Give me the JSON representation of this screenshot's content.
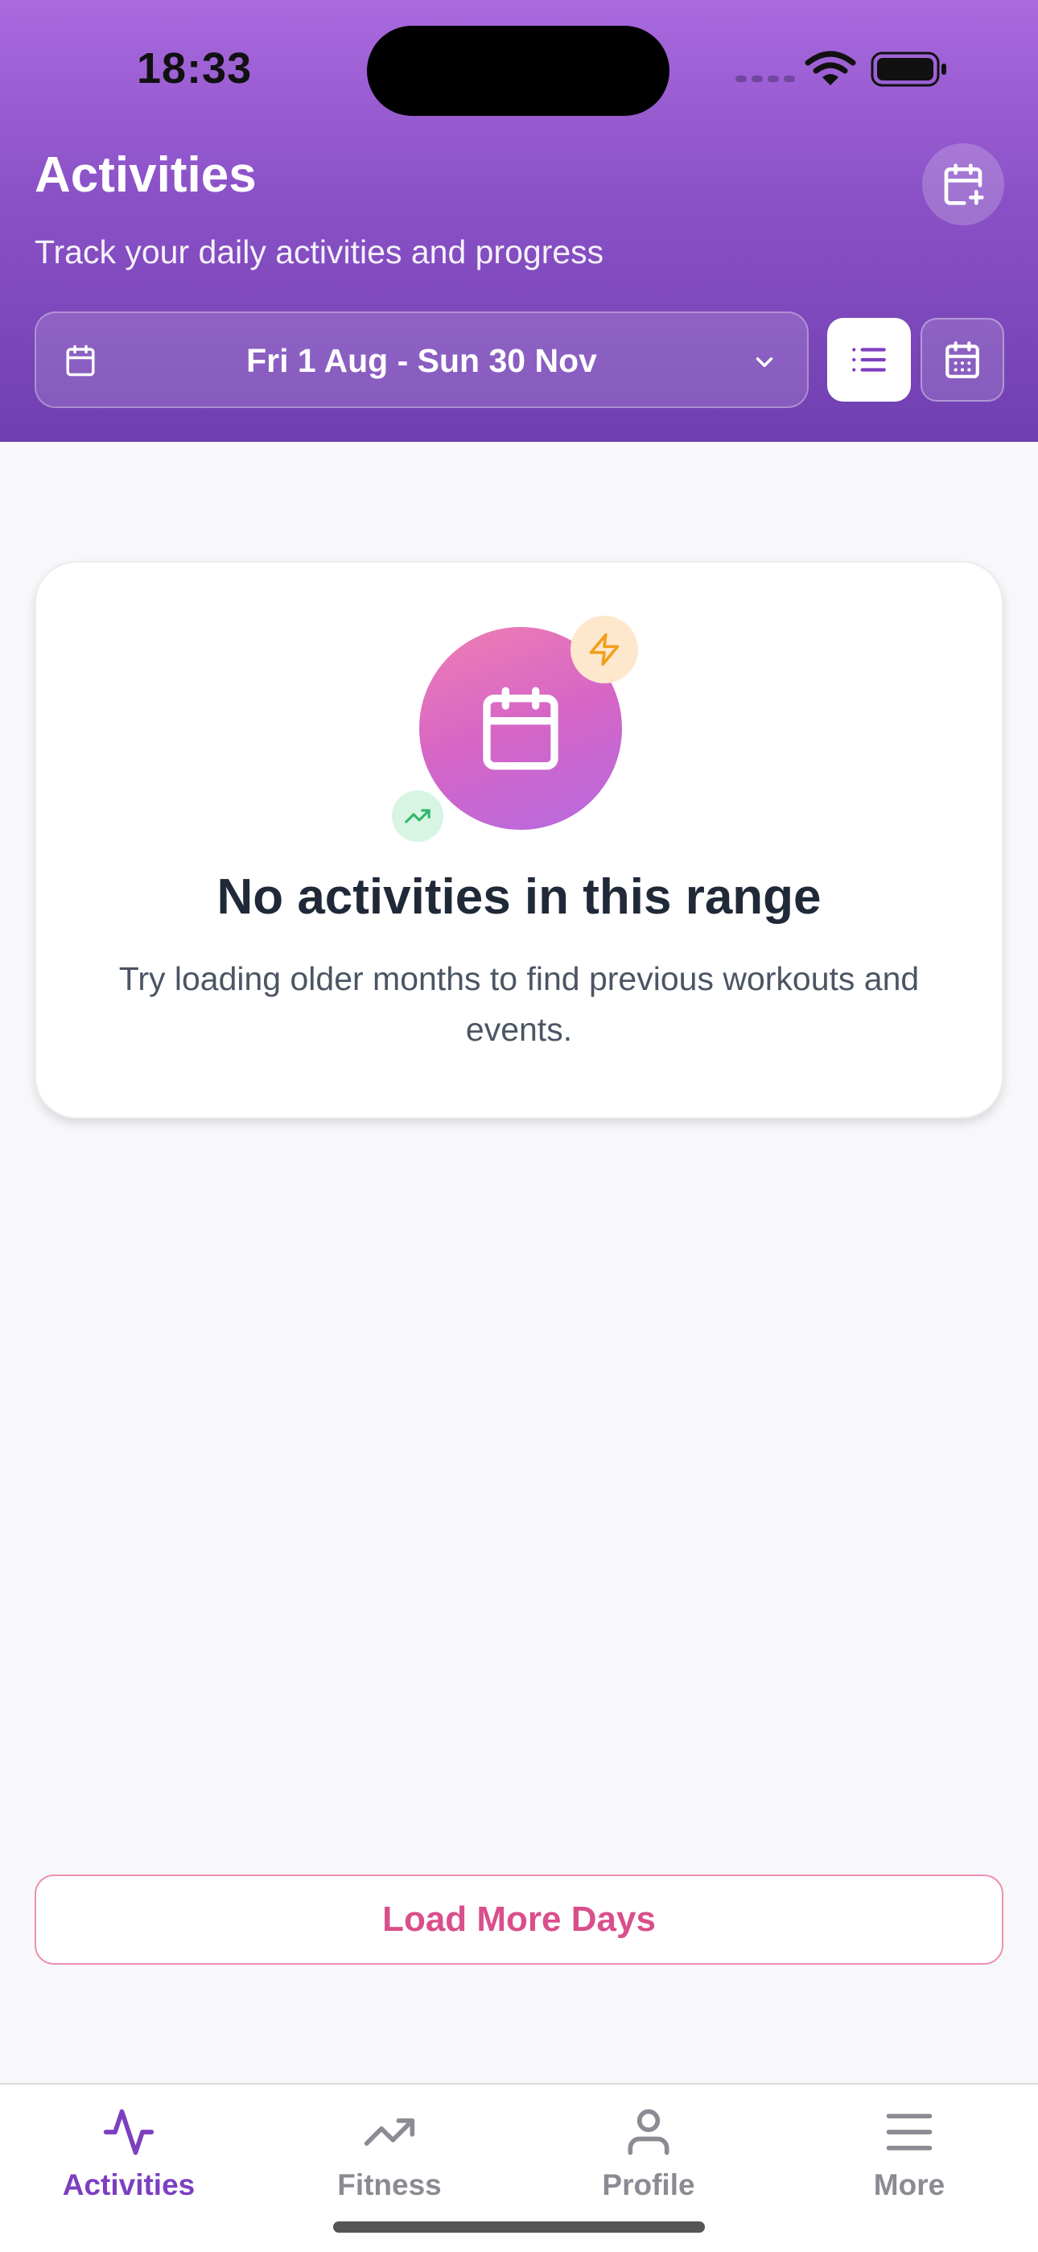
{
  "status_bar": {
    "time": "18:33"
  },
  "header": {
    "title": "Activities",
    "subtitle": "Track your daily activities and progress",
    "date_range": "Fri 1 Aug - Sun 30 Nov",
    "icons": {
      "add_event": "calendar-plus-icon",
      "date_range": "calendar-icon",
      "dropdown": "chevron-down-icon",
      "list_view": "list-icon",
      "calendar_view": "calendar-grid-icon"
    }
  },
  "empty_state": {
    "title": "No activities in this range",
    "description": "Try loading older months to find previous workouts and events.",
    "icons": [
      "calendar-icon",
      "lightning-icon",
      "trending-up-icon"
    ]
  },
  "load_more": {
    "label": "Load More Days"
  },
  "tabbar": {
    "tabs": [
      {
        "label": "Activities",
        "icon": "activity-pulse-icon",
        "active": true
      },
      {
        "label": "Fitness",
        "icon": "trending-up-icon",
        "active": false
      },
      {
        "label": "Profile",
        "icon": "user-icon",
        "active": false
      },
      {
        "label": "More",
        "icon": "menu-icon",
        "active": false
      }
    ]
  },
  "colors": {
    "header_top": "#a96ade",
    "header_bottom": "#6f3fb0",
    "accent_purple": "#7c3fc0",
    "accent_pink": "#d94f8c",
    "text_dark": "#1f2937",
    "text_muted": "#4b5563"
  }
}
